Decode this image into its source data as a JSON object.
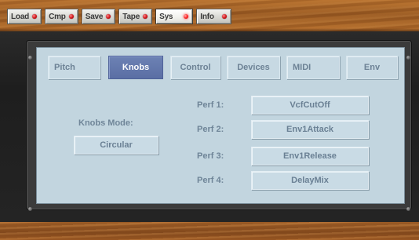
{
  "toolbar": {
    "buttons": [
      {
        "label": "Load"
      },
      {
        "label": "Cmp"
      },
      {
        "label": "Save"
      },
      {
        "label": "Tape"
      },
      {
        "label": "Sys"
      },
      {
        "label": "Info"
      }
    ],
    "active": "Sys"
  },
  "tabs": [
    {
      "label": "Pitch"
    },
    {
      "label": "Knobs"
    },
    {
      "label": "Control"
    },
    {
      "label": "Devices"
    },
    {
      "label": "MIDI"
    },
    {
      "label": "Env"
    }
  ],
  "active_tab": "Knobs",
  "knobs_mode": {
    "label": "Knobs Mode:",
    "value": "Circular"
  },
  "perf": [
    {
      "label": "Perf 1:",
      "value": "VcfCutOff"
    },
    {
      "label": "Perf 2:",
      "value": "Env1Attack"
    },
    {
      "label": "Perf 3:",
      "value": "Env1Release"
    },
    {
      "label": "Perf 4:",
      "value": "DelayMix"
    }
  ],
  "colors": {
    "led": "#d0141a",
    "lcd_background": "#c2d5df",
    "active_tab": "#5a6ea4",
    "text": "#6f8598"
  }
}
